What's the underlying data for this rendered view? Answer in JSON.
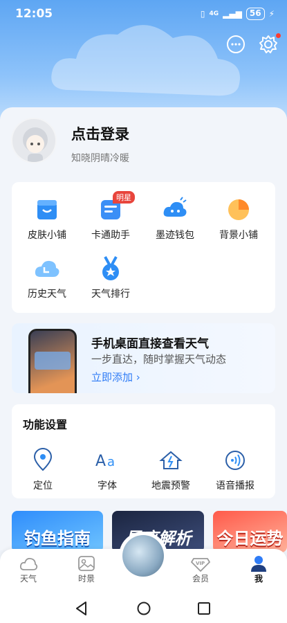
{
  "status": {
    "time": "12:05",
    "signal": "4G",
    "battery": "56"
  },
  "profile": {
    "title": "点击登录",
    "subtitle": "知晓阴晴冷暖"
  },
  "tools": {
    "items": [
      {
        "label": "皮肤小铺",
        "icon": "shop-icon"
      },
      {
        "label": "卡通助手",
        "icon": "cartoon-assistant-icon",
        "badge": "明星"
      },
      {
        "label": "墨迹钱包",
        "icon": "wallet-icon"
      },
      {
        "label": "背景小铺",
        "icon": "background-shop-icon"
      },
      {
        "label": "历史天气",
        "icon": "history-weather-icon"
      },
      {
        "label": "天气排行",
        "icon": "weather-rank-icon"
      }
    ]
  },
  "promo": {
    "title": "手机桌面直接查看天气",
    "subtitle": "一步直达，随时掌握天气动态",
    "link": "立即添加 ›"
  },
  "functions": {
    "title": "功能设置",
    "items": [
      {
        "label": "定位",
        "icon": "location-icon"
      },
      {
        "label": "字体",
        "icon": "font-icon"
      },
      {
        "label": "地震预警",
        "icon": "earthquake-icon"
      },
      {
        "label": "语音播报",
        "icon": "voice-broadcast-icon"
      }
    ]
  },
  "banners": [
    {
      "text": "钓鱼指南"
    },
    {
      "text": "星座解析"
    },
    {
      "text": "今日运势"
    }
  ],
  "tabs": [
    {
      "label": "天气",
      "icon": "cloud-icon"
    },
    {
      "label": "时景",
      "icon": "image-icon"
    },
    {
      "label": "会员",
      "icon": "vip-icon"
    },
    {
      "label": "我",
      "icon": "person-icon"
    }
  ],
  "colors": {
    "accent": "#2f7cf6",
    "hero": "#5ea6f3",
    "badge": "#e8453c"
  }
}
